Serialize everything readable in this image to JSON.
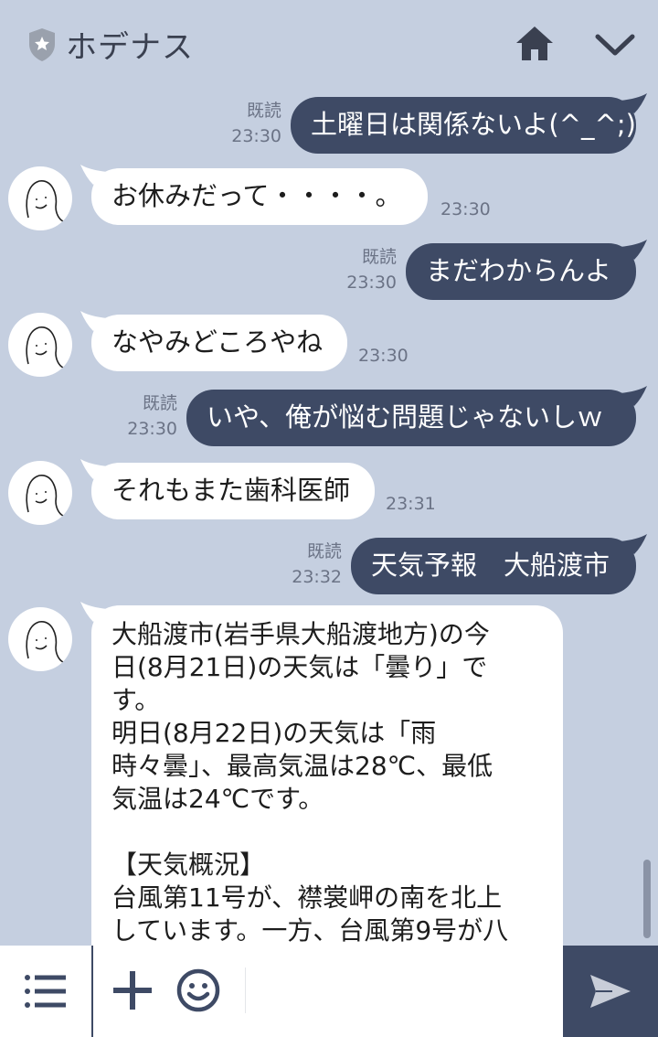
{
  "header": {
    "title": "ホデナス"
  },
  "messages": [
    {
      "dir": "out",
      "text": "土曜日は関係ないよ(^_^;)",
      "read": "既読",
      "time": "23:30"
    },
    {
      "dir": "in",
      "text": "お休みだって・・・・。",
      "time": "23:30"
    },
    {
      "dir": "out",
      "text": "まだわからんよ",
      "read": "既読",
      "time": "23:30"
    },
    {
      "dir": "in",
      "text": "なやみどころやね",
      "time": "23:30"
    },
    {
      "dir": "out",
      "text": "いや、俺が悩む問題じゃないしｗ",
      "read": "既読",
      "time": "23:30"
    },
    {
      "dir": "in",
      "text": "それもまた歯科医師",
      "time": "23:31"
    },
    {
      "dir": "out",
      "text": "天気予報　大船渡市",
      "read": "既読",
      "time": "23:32"
    }
  ],
  "long_message": {
    "para1": "大船渡市(岩手県大船渡地方)の今\n日(8月21日)の天気は「曇り」で\nす。\n明日(8月22日)の天気は「雨\n時々曇」、最高気温は28℃、最低\n気温は24℃です。",
    "heading": "【天気概況】",
    "para2": "台風第11号が、襟裳岬の南を北上\nしています。一方、台風第9号が八"
  },
  "icons": {
    "header": [
      "shield-icon",
      "home-icon",
      "chevron-down-icon"
    ],
    "bottom": [
      "menu-icon",
      "plus-icon",
      "smile-icon",
      "send-icon"
    ]
  },
  "colors": {
    "background": "#c5cfe0",
    "outgoing_bubble": "#3e4a65",
    "incoming_bubble": "#ffffff",
    "meta_text": "#6b7386"
  },
  "input": {
    "value": "",
    "placeholder": ""
  }
}
